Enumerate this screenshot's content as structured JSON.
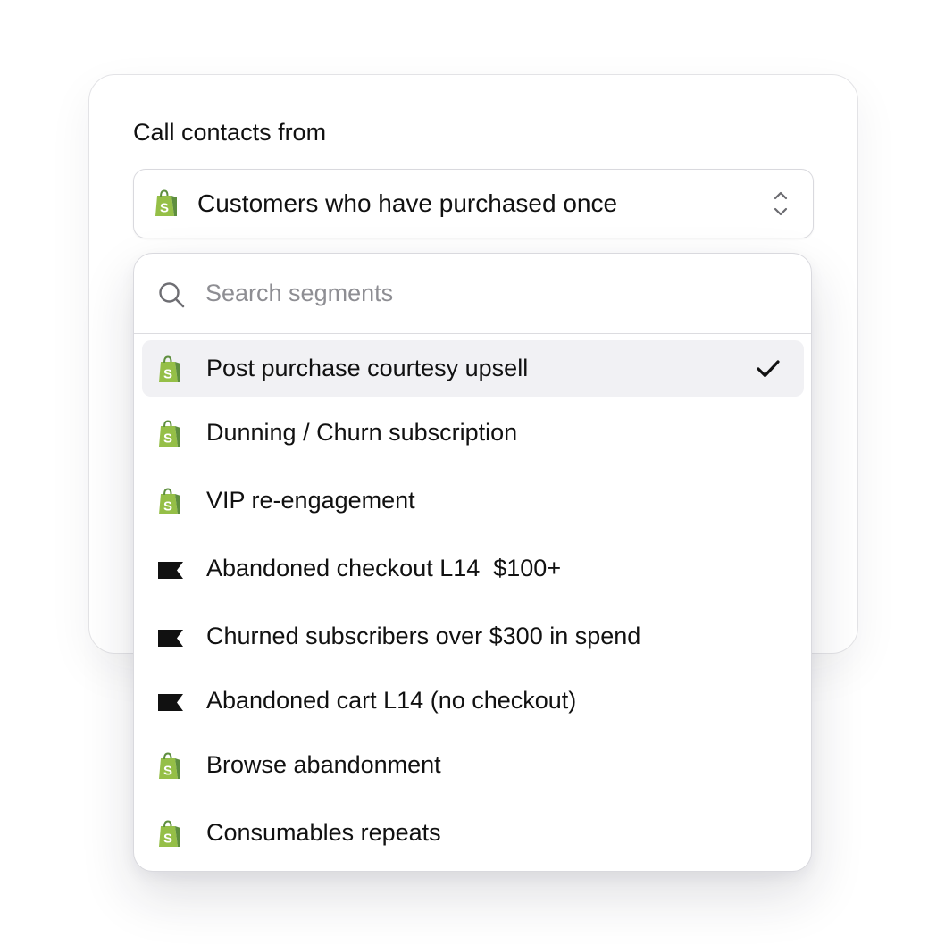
{
  "field": {
    "label": "Call contacts from",
    "selected_value": "Customers who have purchased once",
    "selected_icon": "shopify-bag-icon",
    "toggle_icon": "chevron-up-down-icon"
  },
  "search": {
    "placeholder": "Search segments",
    "value": "",
    "icon": "search-icon"
  },
  "colors": {
    "shopify_green": "#95bf47",
    "shopify_dark_green": "#5e8e3e",
    "flag_black": "#111111",
    "selected_row_bg": "#f1f1f4"
  },
  "options": [
    {
      "label": "Post purchase courtesy upsell",
      "icon": "shopify-bag-icon",
      "selected": true
    },
    {
      "label": "Dunning / Churn subscription",
      "icon": "shopify-bag-icon",
      "selected": false
    },
    {
      "label": "VIP re-engagement",
      "icon": "shopify-bag-icon",
      "selected": false
    },
    {
      "label": "Abandoned checkout L14  $100+",
      "icon": "klaviyo-flag-icon",
      "selected": false
    },
    {
      "label": "Churned subscribers over $300 in spend",
      "icon": "klaviyo-flag-icon",
      "selected": false
    },
    {
      "label": "Abandoned cart L14 (no checkout)",
      "icon": "klaviyo-flag-icon",
      "selected": false
    },
    {
      "label": "Browse abandonment",
      "icon": "shopify-bag-icon",
      "selected": false
    },
    {
      "label": "Consumables repeats",
      "icon": "shopify-bag-icon",
      "selected": false
    }
  ]
}
